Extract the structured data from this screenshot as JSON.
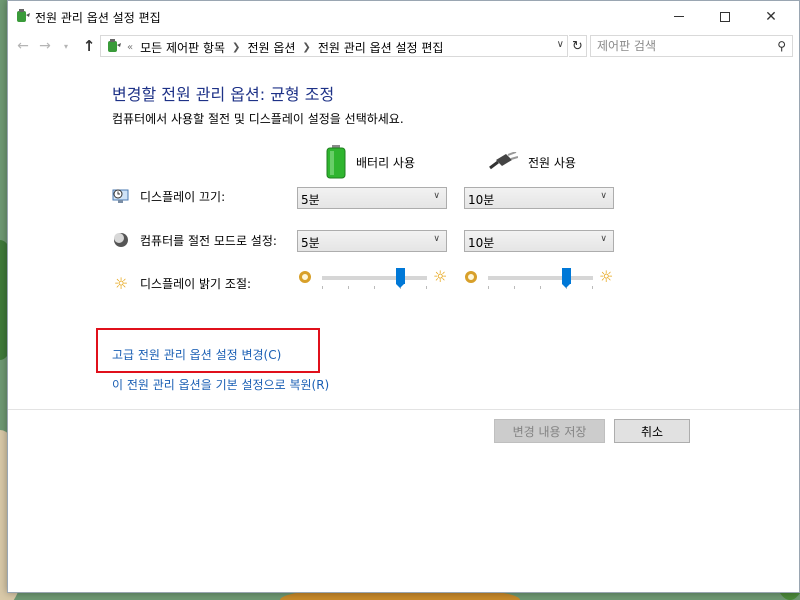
{
  "window": {
    "title": "전원 관리 옵션 설정 편집"
  },
  "nav": {
    "breadcrumb_lead": "«",
    "breadcrumbs": [
      "모든 제어판 항목",
      "전원 옵션",
      "전원 관리 옵션 설정 편집"
    ],
    "search_placeholder": "제어판 검색"
  },
  "page": {
    "title": "변경할 전원 관리 옵션: 균형 조정",
    "subtitle": "컴퓨터에서 사용할 절전 및 디스플레이 설정을 선택하세요."
  },
  "columns": {
    "battery": "배터리 사용",
    "plugged_in": "전원 사용"
  },
  "settings": {
    "display_off": {
      "label": "디스플레이 끄기:",
      "battery_value": "5분",
      "plugged_value": "10분"
    },
    "sleep": {
      "label": "컴퓨터를 절전 모드로 설정:",
      "battery_value": "5분",
      "plugged_value": "10분"
    },
    "brightness": {
      "label": "디스플레이 밝기 조절:",
      "battery_level": 0.75,
      "plugged_level": 0.75
    }
  },
  "links": {
    "advanced": "고급 전원 관리 옵션 설정 변경(C)",
    "restore": "이 전원 관리 옵션을 기본 설정으로 복원(R)"
  },
  "buttons": {
    "save": "변경 내용 저장",
    "cancel": "취소"
  },
  "colors": {
    "title_blue": "#1e3287",
    "link_blue": "#1a5fb4",
    "slider_accent": "#0078d7",
    "highlight_red": "#e0101b"
  }
}
